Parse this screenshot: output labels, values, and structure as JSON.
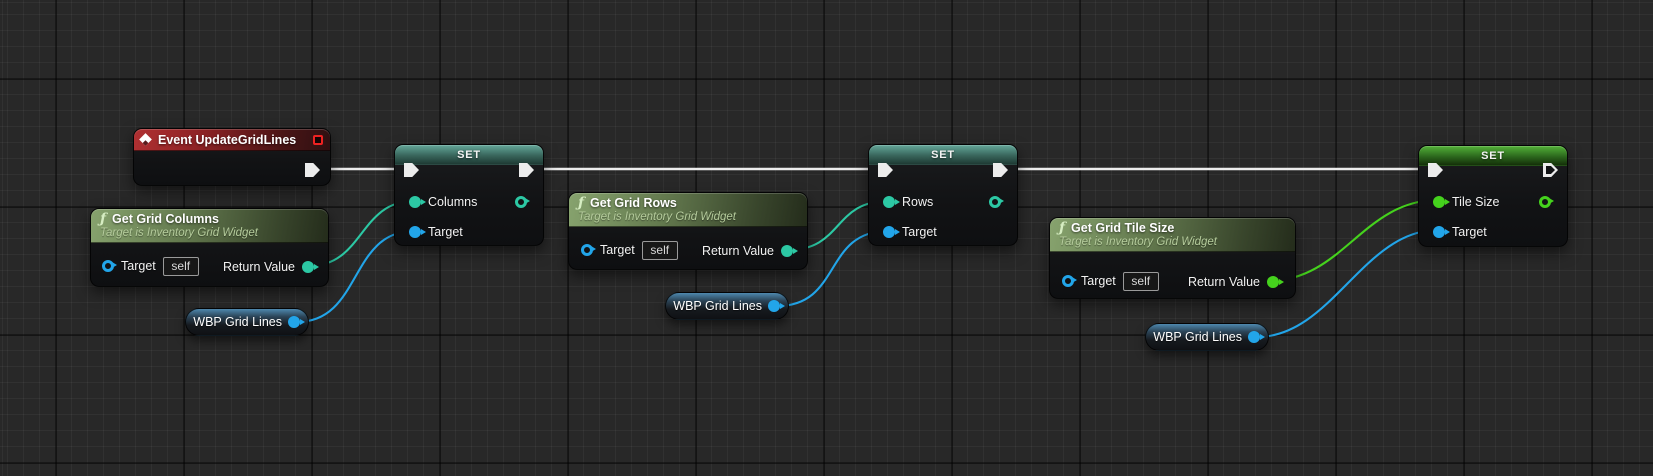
{
  "graph": {
    "event_node": {
      "title": "Event UpdateGridLines"
    },
    "function_nodes": [
      {
        "title": "Get Grid Columns",
        "subtitle": "Target is Inventory Grid Widget",
        "target_label": "Target",
        "target_value": "self",
        "return_label": "Return Value"
      },
      {
        "title": "Get Grid Rows",
        "subtitle": "Target is Inventory Grid Widget",
        "target_label": "Target",
        "target_value": "self",
        "return_label": "Return Value"
      },
      {
        "title": "Get Grid Tile Size",
        "subtitle": "Target is Inventory Grid Widget",
        "target_label": "Target",
        "target_value": "self",
        "return_label": "Return Value"
      }
    ],
    "set_nodes": [
      {
        "title": "SET",
        "value_label": "Columns",
        "target_label": "Target"
      },
      {
        "title": "SET",
        "value_label": "Rows",
        "target_label": "Target"
      },
      {
        "title": "SET",
        "value_label": "Tile Size",
        "target_label": "Target"
      }
    ],
    "variable_nodes": [
      {
        "label": "WBP Grid Lines"
      },
      {
        "label": "WBP Grid Lines"
      },
      {
        "label": "WBP Grid Lines"
      }
    ],
    "connections": [
      {
        "from": "Event UpdateGridLines.exec",
        "to": "SET Columns.exec",
        "type": "exec"
      },
      {
        "from": "SET Columns.exec",
        "to": "SET Rows.exec",
        "type": "exec"
      },
      {
        "from": "SET Rows.exec",
        "to": "SET Tile Size.exec",
        "type": "exec"
      },
      {
        "from": "Get Grid Columns.Return Value",
        "to": "SET Columns.Columns",
        "type": "int"
      },
      {
        "from": "WBP Grid Lines.value",
        "to": "SET Columns.Target",
        "type": "object"
      },
      {
        "from": "Get Grid Rows.Return Value",
        "to": "SET Rows.Rows",
        "type": "int"
      },
      {
        "from": "WBP Grid Lines.value",
        "to": "SET Rows.Target",
        "type": "object"
      },
      {
        "from": "Get Grid Tile Size.Return Value",
        "to": "SET Tile Size.Tile Size",
        "type": "float"
      },
      {
        "from": "WBP Grid Lines.value",
        "to": "SET Tile Size.Target",
        "type": "object"
      }
    ]
  },
  "colors": {
    "background": "#282828",
    "exec_wire": "#ececec",
    "int_pin": "#2cc8a4",
    "float_pin": "#45d21d",
    "object_pin": "#22a5e9",
    "event_header": "#a12527",
    "function_header": "#6d8457",
    "set_int_header": "#4c8a7c",
    "set_float_header": "#3f9b2a"
  }
}
